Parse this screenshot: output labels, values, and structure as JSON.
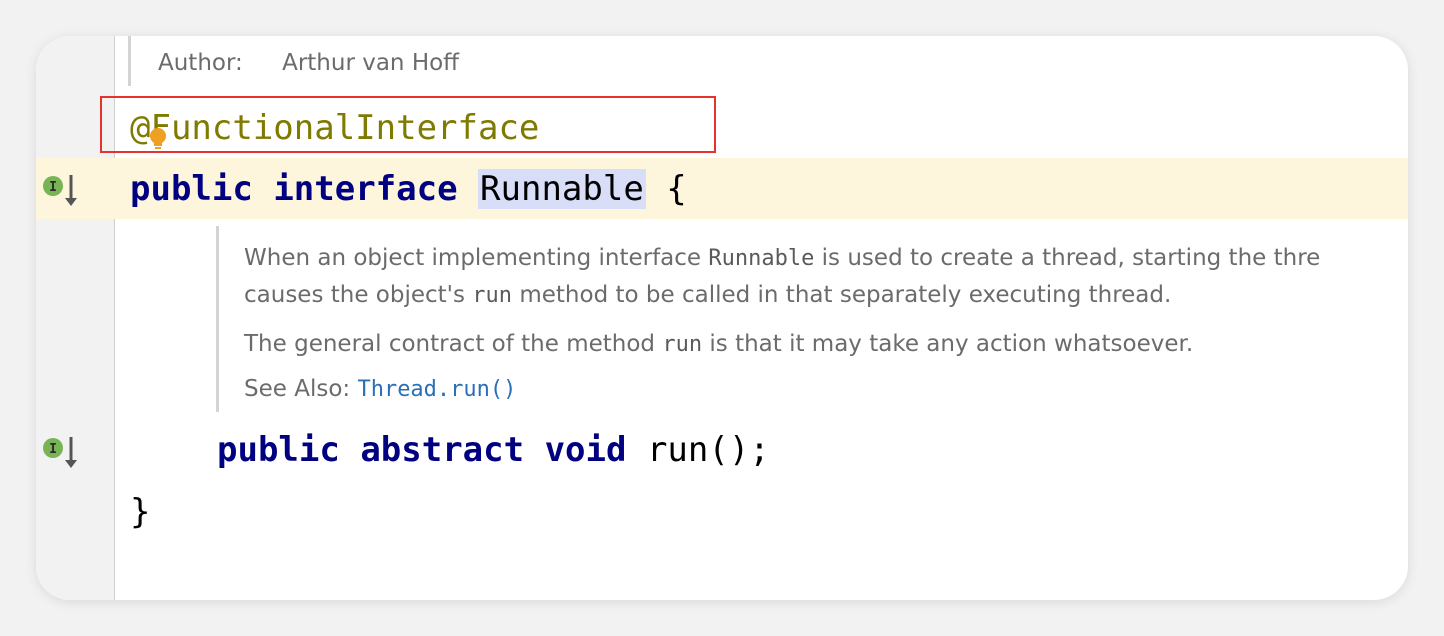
{
  "author": {
    "label": "Author:",
    "value": "Arthur van Hoff"
  },
  "annotation": "@FunctionalInterface",
  "declaration": {
    "kw1": "public",
    "kw2": "interface",
    "name": "Runnable",
    "brace": "{"
  },
  "javadoc": {
    "line1_a": "When an object implementing interface ",
    "line1_code": "Runnable",
    "line1_b": " is used to create a thread, starting the thre",
    "line2_a": "causes the object's ",
    "line2_code": "run",
    "line2_b": " method to be called in that separately executing thread.",
    "line3_a": "The general contract of the method ",
    "line3_code": "run",
    "line3_b": " is that it may take any action whatsoever.",
    "see_label": "See Also: ",
    "see_link": "Thread.run()"
  },
  "method": {
    "kw1": "public",
    "kw2": "abstract",
    "kw3": "void",
    "sig": "run();"
  },
  "closing_brace": "}",
  "gutter_icon_letter": "I",
  "colors": {
    "annotation": "#7f7a00",
    "keyword": "#000080",
    "highlight": "#fdf6dd",
    "selection_box": "#e5322d",
    "link": "#2a6fb8"
  }
}
